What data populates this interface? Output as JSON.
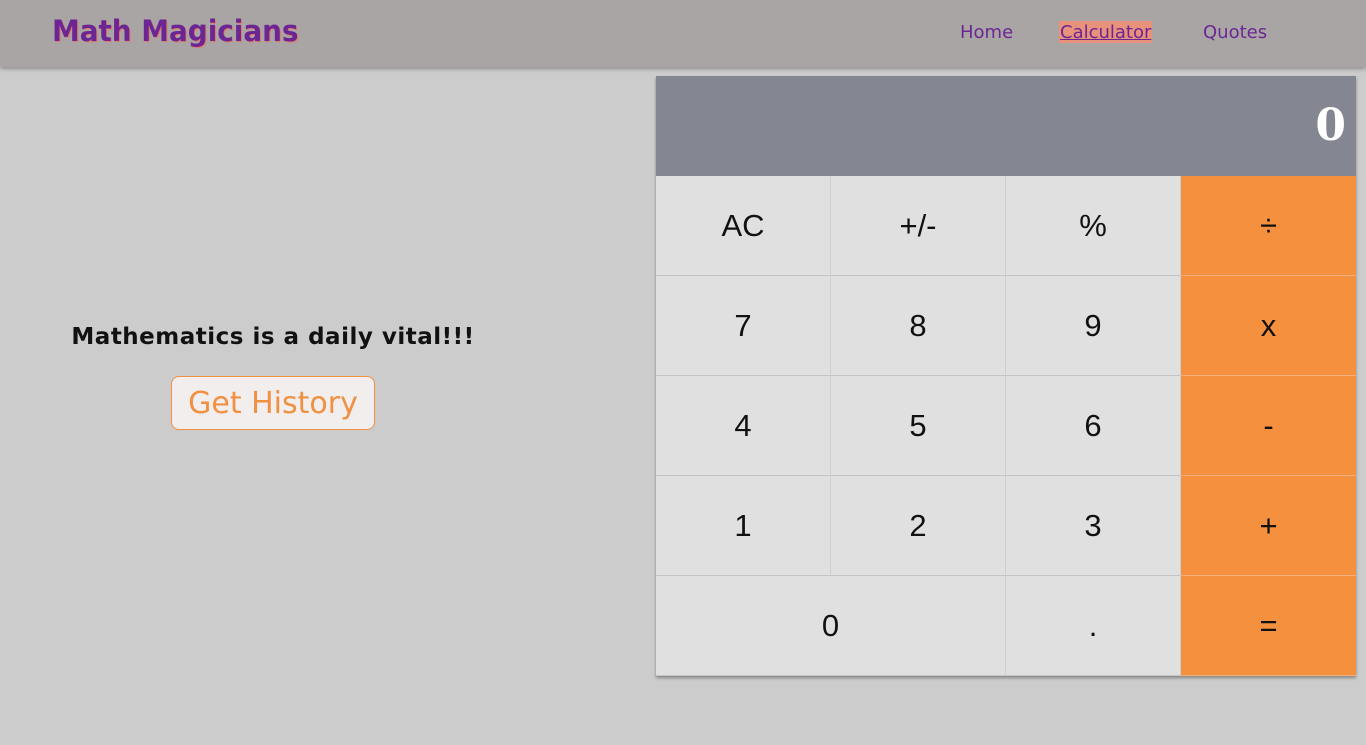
{
  "navbar": {
    "brand": "Math Magicians",
    "links": [
      {
        "label": "Home",
        "active": false
      },
      {
        "label": "Calculator",
        "active": true
      },
      {
        "label": "Quotes",
        "active": false
      }
    ]
  },
  "main": {
    "tagline": "Mathematics is a daily vital!!!",
    "history_button": "Get History"
  },
  "calculator": {
    "display": "0",
    "keys": {
      "ac": "AC",
      "plus_minus": "+/-",
      "percent": "%",
      "divide": "÷",
      "seven": "7",
      "eight": "8",
      "nine": "9",
      "multiply": "x",
      "four": "4",
      "five": "5",
      "six": "6",
      "minus": "-",
      "one": "1",
      "two": "2",
      "three": "3",
      "plus": "+",
      "zero": "0",
      "dot": ".",
      "equals": "="
    }
  },
  "colors": {
    "navbar_bg": "#a9a5a4",
    "brand": "#6b2694",
    "active_link_bg": "#e8917b",
    "page_bg": "#cccccc",
    "display_bg": "#848691",
    "key_bg": "#e0e0e0",
    "operator_bg": "#f5913e",
    "history_button_accent": "#f09040"
  }
}
